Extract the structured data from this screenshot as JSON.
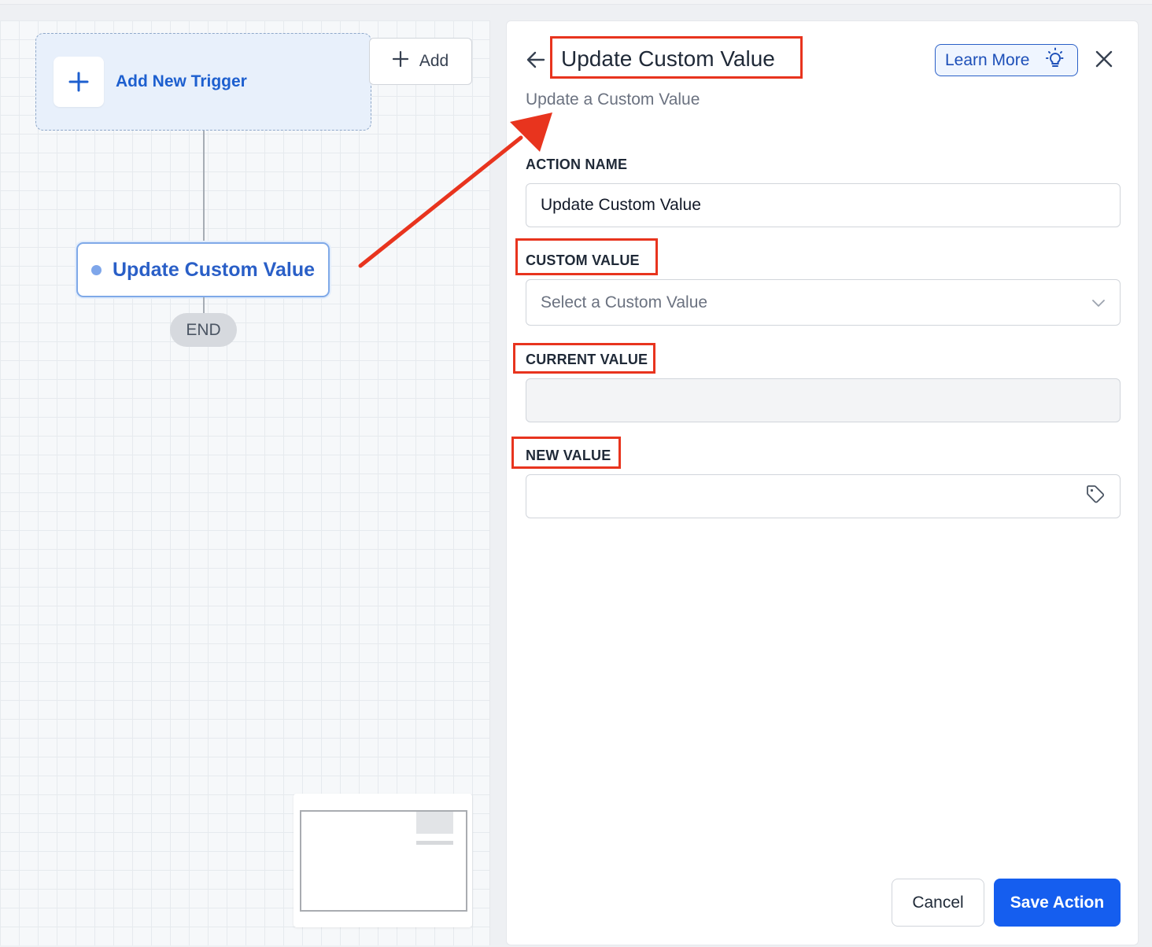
{
  "canvas": {
    "trigger_label": "Add New Trigger",
    "add_button_label": "Add",
    "action_node_label": "Update Custom Value",
    "end_label": "END"
  },
  "panel": {
    "title": "Update Custom Value",
    "subtitle": "Update a Custom Value",
    "learn_more_label": "Learn More",
    "fields": {
      "action_name": {
        "label": "ACTION NAME",
        "value": "Update Custom Value"
      },
      "custom_value": {
        "label": "CUSTOM VALUE",
        "placeholder": "Select a Custom Value"
      },
      "current_value": {
        "label": "CURRENT VALUE",
        "value": ""
      },
      "new_value": {
        "label": "NEW VALUE",
        "value": ""
      }
    },
    "cancel_label": "Cancel",
    "save_label": "Save Action"
  },
  "colors": {
    "accent": "#155eef",
    "annotation": "#e8341e",
    "node_text": "#2a5fc7"
  },
  "icons": [
    "plus-icon",
    "back-arrow-icon",
    "lightbulb-icon",
    "close-icon",
    "chevron-down-icon",
    "tag-icon"
  ]
}
